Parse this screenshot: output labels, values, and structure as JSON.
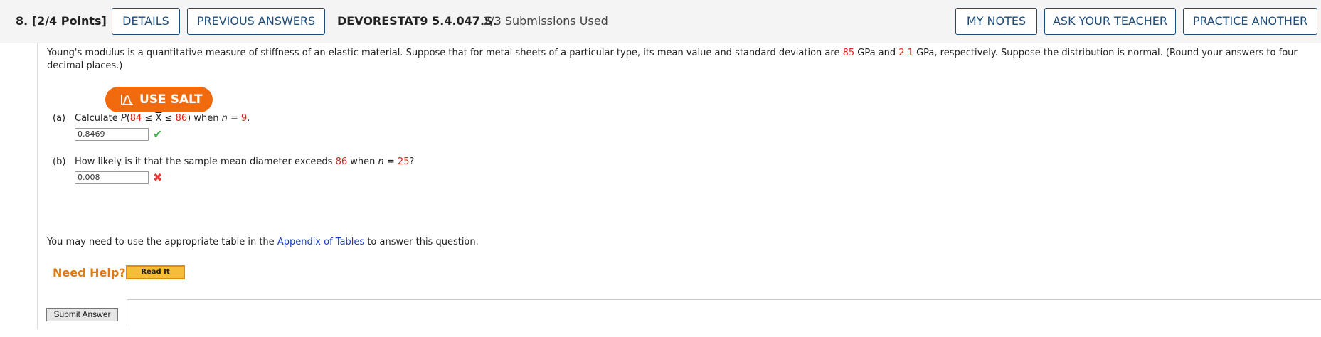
{
  "header": {
    "question_label": "8.  [2/4 Points]",
    "details_label": "DETAILS",
    "previous_answers_label": "PREVIOUS ANSWERS",
    "code": "DEVORESTAT9 5.4.047.S.",
    "submissions": "2/3 Submissions Used",
    "my_notes_label": "MY NOTES",
    "ask_teacher_label": "ASK YOUR TEACHER",
    "practice_label": "PRACTICE ANOTHER"
  },
  "intro": {
    "text1": "Young's modulus is a quantitative measure of stiffness of an elastic material. Suppose that for metal sheets of a particular type, its mean value and standard deviation are ",
    "mean": "85",
    "text2": " GPa and ",
    "sd": "2.1",
    "text3": " GPa, respectively. Suppose the distribution is normal. (Round your answers to four decimal places.)"
  },
  "salt": {
    "label": "USE SALT",
    "icon": "chart-icon"
  },
  "part_a": {
    "label": "(a)",
    "t1": "Calculate ",
    "p": "P",
    "paren_open": "(",
    "low": "84",
    "le1": " ≤ ",
    "xbar": "X",
    "le2": " ≤ ",
    "high": "86",
    "t2": ") when ",
    "n": "n",
    "eq": " = ",
    "n_val": "9",
    "dot": ".",
    "answer": "0.8469",
    "status": "correct",
    "mark": "✔",
    "mark_color": "#4caf50"
  },
  "part_b": {
    "label": "(b)",
    "t1": "How likely is it that the sample mean diameter exceeds ",
    "val": "86",
    "t2": " when ",
    "n": "n",
    "eq": " = ",
    "n_val": "25",
    "q": "?",
    "answer": "0.008",
    "status": "incorrect",
    "mark": "✖",
    "mark_color": "#e53935"
  },
  "note": {
    "t1": "You may need to use the appropriate table in the ",
    "link": "Appendix of Tables",
    "t2": " to answer this question."
  },
  "help": {
    "label": "Need Help?",
    "read_it": "Read It"
  },
  "submit_label": "Submit Answer",
  "colors": {
    "accent_blue": "#1f4d7a",
    "salt_orange": "#f26a0e",
    "value_red": "#e0201a",
    "link_blue": "#1a3cc4",
    "help_orange": "#e07b14"
  }
}
